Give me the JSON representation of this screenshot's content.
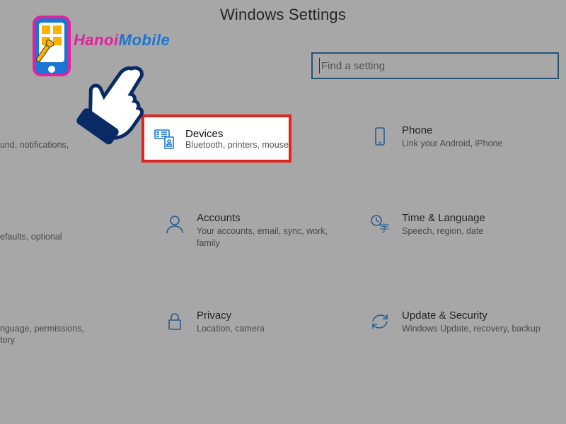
{
  "page": {
    "title": "Windows Settings"
  },
  "search": {
    "placeholder": "Find a setting",
    "value": ""
  },
  "watermark": {
    "text_part1": "Hanoi",
    "text_part2": "Mobile"
  },
  "left_fragments": {
    "row1": "und, notifications,",
    "row2": "efaults, optional",
    "row3": "nguage, permissions,",
    "row3b": "tory"
  },
  "tiles": {
    "devices": {
      "title": "Devices",
      "subtitle": "Bluetooth, printers, mouse"
    },
    "phone": {
      "title": "Phone",
      "subtitle": "Link your Android, iPhone"
    },
    "accounts": {
      "title": "Accounts",
      "subtitle": "Your accounts, email, sync, work, family"
    },
    "time_language": {
      "title": "Time & Language",
      "subtitle": "Speech, region, date"
    },
    "privacy": {
      "title": "Privacy",
      "subtitle": "Location, camera"
    },
    "update_security": {
      "title": "Update & Security",
      "subtitle": "Windows Update, recovery, backup"
    }
  }
}
